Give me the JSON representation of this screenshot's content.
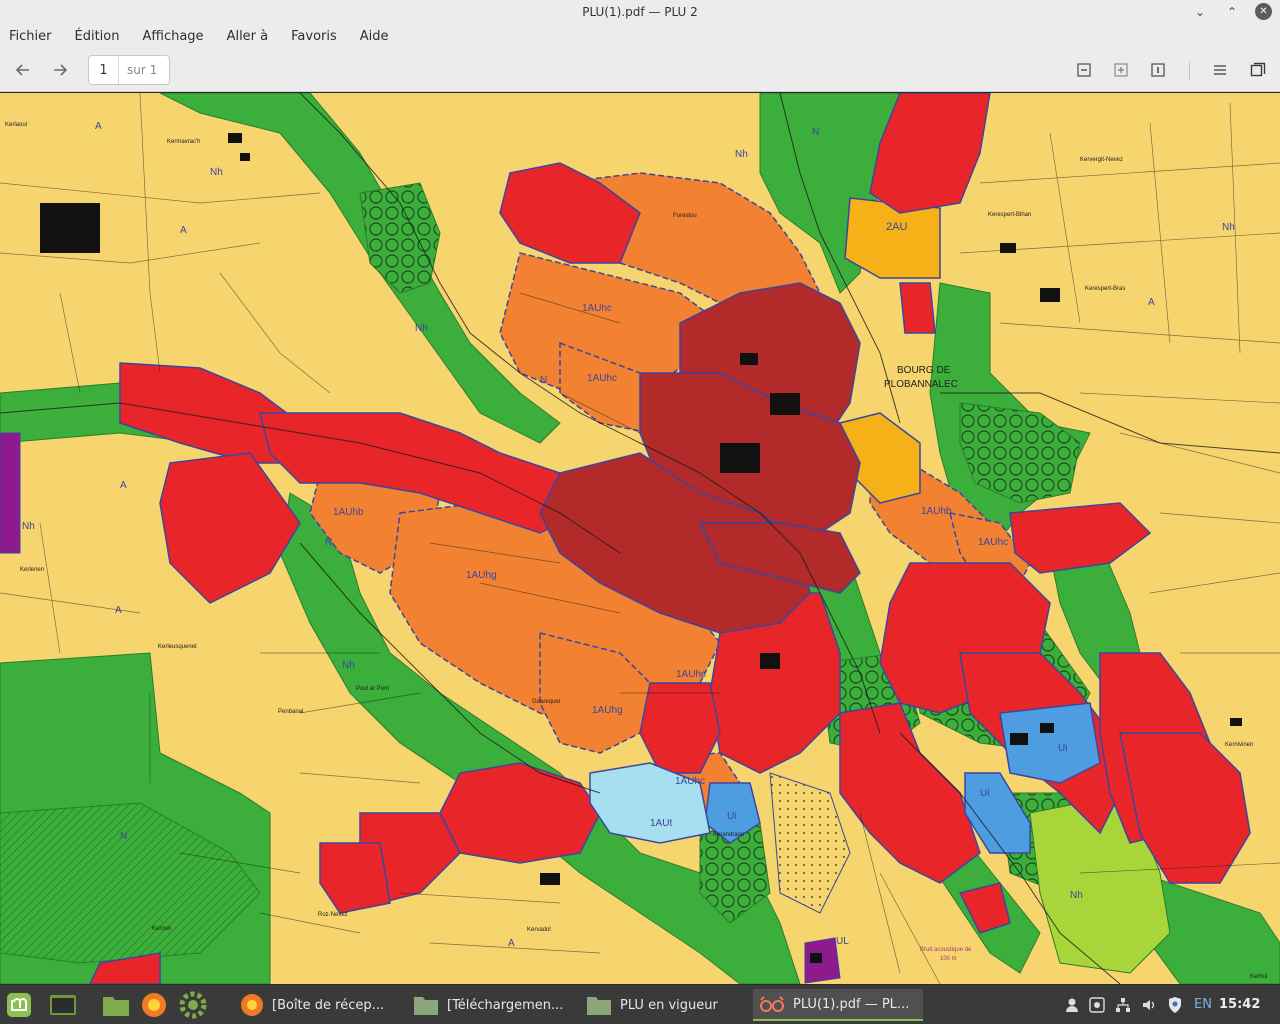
{
  "window": {
    "title": "PLU(1).pdf — PLU 2",
    "controls": {
      "minimize": "⌄",
      "maximize": "⌃",
      "close": "✕"
    }
  },
  "menu": [
    "Fichier",
    "Édition",
    "Affichage",
    "Aller à",
    "Favoris",
    "Aide"
  ],
  "toolbar": {
    "page_current": "1",
    "page_total_label": "sur 1"
  },
  "map": {
    "zone_labels": [
      "A",
      "N",
      "Nh",
      "2AU",
      "1AUhc",
      "1AUhb",
      "1AUhg",
      "1AUt",
      "UL",
      "Ui"
    ],
    "place_names": [
      "Kermavrac'h",
      "Kerlaoui",
      "Kervergit-Nevez",
      "Kerespert-Bihan",
      "Kerespert-Bras",
      "BOURG DE",
      "PLOBANNALEC",
      "Kerlerien",
      "Kerleusquenet",
      "Penbanal",
      "Poul ar Pont",
      "Goarequer",
      "Kerandraon",
      "Kervadol",
      "Roz-Nevez",
      "Keroun",
      "Kernivinen",
      "Forestou",
      "Kerhol",
      "Bruit acoustique de",
      "100 m"
    ],
    "colors": {
      "agricultural": "#f7d56e",
      "natural": "#3cae3c",
      "urban_dense": "#b22a2a",
      "urban": "#e8262a",
      "future_urban": "#f28232",
      "future_reserve": "#f6b118",
      "leisure": "#4d9de0",
      "tourism": "#a8dff0",
      "special": "#8e1b8e",
      "boundary": "#3a46a0"
    }
  },
  "taskbar": {
    "launchers": [
      "mint-menu-icon",
      "terminal-icon",
      "files-icon",
      "firefox-icon",
      "settings-icon"
    ],
    "windows": [
      {
        "label": "[Boîte de récep...",
        "icon": "thunderbird-icon",
        "active": false
      },
      {
        "label": "[Téléchargemen...",
        "icon": "folder-icon",
        "active": false
      },
      {
        "label": "PLU en vigueur",
        "icon": "folder-icon",
        "active": false
      },
      {
        "label": "PLU(1).pdf — PL...",
        "icon": "document-viewer-icon",
        "active": true
      }
    ],
    "tray": {
      "lang": "EN",
      "clock": "15:42"
    }
  }
}
